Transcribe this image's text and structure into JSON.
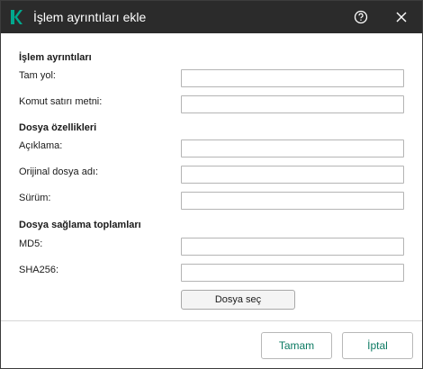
{
  "colors": {
    "titlebar_bg": "#2b2b2b",
    "accent": "#00a88e",
    "button_text": "#0b7a62"
  },
  "window": {
    "title": "İşlem ayrıntıları ekle",
    "logo_icon": "kaspersky-k-logo",
    "help_icon": "question-circle-icon",
    "close_icon": "close-icon"
  },
  "sections": {
    "process_details": "İşlem ayrıntıları",
    "file_properties": "Dosya özellikleri",
    "checksums": "Dosya sağlama toplamları"
  },
  "fields": {
    "full_path": {
      "label": "Tam yol:",
      "value": ""
    },
    "command_line": {
      "label": "Komut satırı metni:",
      "value": ""
    },
    "description": {
      "label": "Açıklama:",
      "value": ""
    },
    "original_file_name": {
      "label": "Orijinal dosya adı:",
      "value": ""
    },
    "version": {
      "label": "Sürüm:",
      "value": ""
    },
    "md5": {
      "label": "MD5:",
      "value": ""
    },
    "sha256": {
      "label": "SHA256:",
      "value": ""
    }
  },
  "buttons": {
    "choose_file": "Dosya seç",
    "ok": "Tamam",
    "cancel": "İptal"
  }
}
